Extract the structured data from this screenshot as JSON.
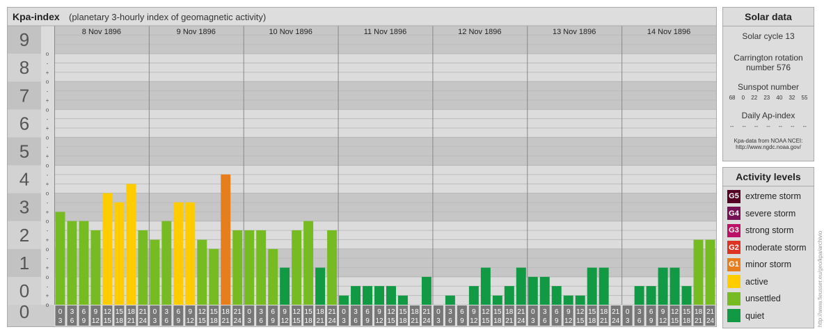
{
  "title": "Kpa-index",
  "subtitle": "(planetary 3-hourly index of geomagnetic activity)",
  "chart_data": {
    "type": "bar",
    "title": "Kpa-index",
    "subtitle": "(planetary 3-hourly index of geomagnetic activity)",
    "ylim": [
      0,
      9
    ],
    "y_tick_labels": [
      "0",
      "1",
      "2",
      "3",
      "4",
      "5",
      "6",
      "7",
      "8",
      "9"
    ],
    "minor_tick_labels": [
      "o",
      "+",
      "-",
      "o"
    ],
    "days": [
      "8 Nov 1896",
      "9 Nov 1896",
      "10 Nov 1896",
      "11 Nov 1896",
      "12 Nov 1896",
      "13 Nov 1896",
      "14 Nov 1896"
    ],
    "interval_starts": [
      "0",
      "3",
      "6",
      "9",
      "12",
      "15",
      "18",
      "21"
    ],
    "interval_ends": [
      "3",
      "6",
      "9",
      "12",
      "15",
      "18",
      "21",
      "24"
    ],
    "values": [
      [
        3.33,
        3.0,
        3.0,
        2.67,
        4.0,
        3.67,
        4.33,
        2.67
      ],
      [
        2.33,
        3.0,
        3.67,
        3.67,
        2.33,
        2.0,
        4.67,
        2.67
      ],
      [
        2.67,
        2.67,
        2.0,
        1.33,
        2.67,
        3.0,
        1.33,
        2.67
      ],
      [
        0.33,
        0.67,
        0.67,
        0.67,
        0.67,
        0.33,
        0.0,
        1.0
      ],
      [
        0.0,
        0.33,
        0.0,
        0.67,
        1.33,
        0.33,
        0.67,
        1.33
      ],
      [
        1.0,
        1.0,
        0.67,
        0.33,
        0.33,
        1.33,
        1.33,
        0.0
      ],
      [
        0.0,
        0.67,
        0.67,
        1.33,
        1.33,
        0.67,
        2.33,
        2.33
      ]
    ],
    "colors": {
      "quiet": "#119944",
      "unsettled": "#77bb22",
      "active": "#ffcc00",
      "minor_storm": "#e67e1e",
      "moderate_storm": "#dd3322",
      "strong_storm": "#bb1166",
      "severe_storm": "#771155",
      "extreme_storm": "#550022"
    }
  },
  "solar": {
    "heading": "Solar data",
    "cycle": "Solar cycle 13",
    "carrington_line1": "Carrington rotation",
    "carrington_line2": "number 576",
    "sunspot_label": "Sunspot number",
    "sunspot_values": [
      "68",
      "0",
      "22",
      "23",
      "40",
      "32",
      "55"
    ],
    "ap_label": "Daily Ap-index",
    "ap_values": [
      "--",
      "--",
      "--",
      "--",
      "--",
      "--",
      "--"
    ],
    "source_line1": "Kpa-data from NOAA NCEI:",
    "source_line2": "http://www.ngdc.noaa.gov/"
  },
  "levels": {
    "heading": "Activity levels",
    "items": [
      {
        "badge": "G5",
        "label": "extreme storm",
        "color": "#550022"
      },
      {
        "badge": "G4",
        "label": "severe storm",
        "color": "#771155"
      },
      {
        "badge": "G3",
        "label": "strong storm",
        "color": "#bb1166"
      },
      {
        "badge": "G2",
        "label": "moderate storm",
        "color": "#dd3322"
      },
      {
        "badge": "G1",
        "label": "minor storm",
        "color": "#e67e1e"
      },
      {
        "badge": "",
        "label": "active",
        "color": "#ffcc00"
      },
      {
        "badge": "",
        "label": "unsettled",
        "color": "#77bb22"
      },
      {
        "badge": "",
        "label": "quiet",
        "color": "#119944"
      }
    ]
  },
  "credit": "http://www.fieusser.eu/geo/kpa/archivio"
}
